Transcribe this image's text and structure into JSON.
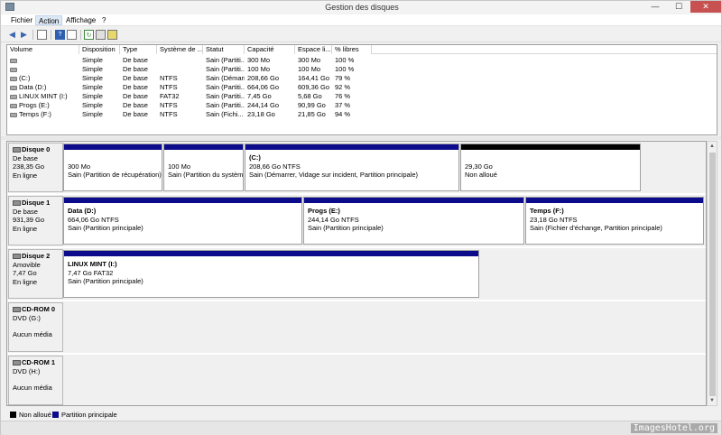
{
  "window": {
    "title": "Gestion des disques",
    "minimize": "—",
    "maximize": "☐",
    "close": "✕"
  },
  "menu": [
    "Fichier",
    "Action",
    "Affichage",
    "?"
  ],
  "volume_table": {
    "columns": [
      "Volume",
      "Disposition",
      "Type",
      "Système de ...",
      "Statut",
      "Capacité",
      "Espace li...",
      "% libres"
    ],
    "rows": [
      [
        "",
        "Simple",
        "De base",
        "",
        "Sain (Partiti...",
        "300 Mo",
        "300 Mo",
        "100 %"
      ],
      [
        "",
        "Simple",
        "De base",
        "",
        "Sain (Partiti...",
        "100 Mo",
        "100 Mo",
        "100 %"
      ],
      [
        "(C:)",
        "Simple",
        "De base",
        "NTFS",
        "Sain (Démarr...",
        "208,66 Go",
        "164,41 Go",
        "79 %"
      ],
      [
        "Data (D:)",
        "Simple",
        "De base",
        "NTFS",
        "Sain (Partiti...",
        "664,06 Go",
        "609,36 Go",
        "92 %"
      ],
      [
        "LINUX MINT (I:)",
        "Simple",
        "De base",
        "FAT32",
        "Sain (Partiti...",
        "7,45 Go",
        "5,68 Go",
        "76 %"
      ],
      [
        "Progs (E:)",
        "Simple",
        "De base",
        "NTFS",
        "Sain (Partiti...",
        "244,14 Go",
        "90,99 Go",
        "37 %"
      ],
      [
        "Temps (F:)",
        "Simple",
        "De base",
        "NTFS",
        "Sain (Fichi...",
        "23,18 Go",
        "21,85 Go",
        "94 %"
      ]
    ]
  },
  "disks": [
    {
      "name": "Disque 0",
      "type": "De base",
      "size": "238,35 Go",
      "status": "En ligne",
      "partitions": [
        {
          "title": "",
          "size": "300 Mo",
          "status": "Sain (Partition de récupération)",
          "kind": "primary"
        },
        {
          "title": "",
          "size": "100 Mo",
          "status": "Sain (Partition du système",
          "kind": "primary"
        },
        {
          "title": "(C:)",
          "size": "208,66 Go NTFS",
          "status": "Sain (Démarrer, Vidage sur incident, Partition principale)",
          "kind": "primary"
        },
        {
          "title": "",
          "size": "29,30 Go",
          "status": "Non alloué",
          "kind": "unallocated"
        }
      ]
    },
    {
      "name": "Disque 1",
      "type": "De base",
      "size": "931,39 Go",
      "status": "En ligne",
      "partitions": [
        {
          "title": "Data (D:)",
          "size": "664,06 Go NTFS",
          "status": "Sain (Partition principale)",
          "kind": "primary"
        },
        {
          "title": "Progs (E:)",
          "size": "244,14 Go NTFS",
          "status": "Sain (Partition principale)",
          "kind": "primary"
        },
        {
          "title": "Temps (F:)",
          "size": "23,18 Go NTFS",
          "status": "Sain (Fichier d'échange, Partition principale)",
          "kind": "primary"
        }
      ]
    },
    {
      "name": "Disque 2",
      "type": "Amovible",
      "size": "7,47 Go",
      "status": "En ligne",
      "partitions": [
        {
          "title": "LINUX MINT (I:)",
          "size": "7,47 Go FAT32",
          "status": "Sain (Partition principale)",
          "kind": "primary"
        }
      ]
    },
    {
      "name": "CD-ROM 0",
      "type": "DVD (G:)",
      "size": "",
      "status": "Aucun média",
      "partitions": []
    },
    {
      "name": "CD-ROM 1",
      "type": "DVD (H:)",
      "size": "",
      "status": "Aucun média",
      "partitions": []
    }
  ],
  "legend": [
    {
      "label": "Non alloué",
      "color": "#000000"
    },
    {
      "label": "Partition principale",
      "color": "#0b0b8c"
    }
  ],
  "watermark": "ImagesHotel.org"
}
